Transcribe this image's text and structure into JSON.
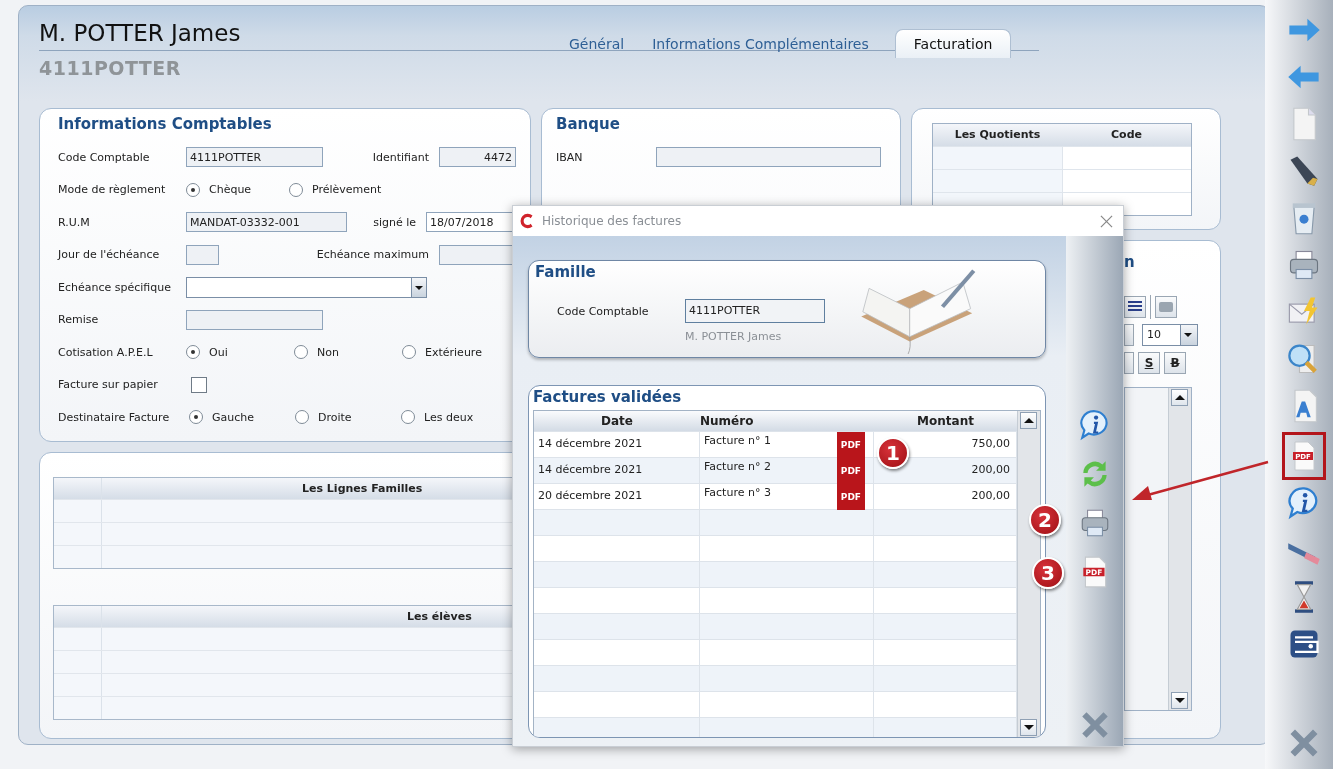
{
  "header": {
    "name": "M. POTTER James",
    "code": "4111POTTER"
  },
  "tabs": [
    {
      "label": "Général",
      "selected": false
    },
    {
      "label": "Informations Complémentaires",
      "selected": false
    },
    {
      "label": "Facturation",
      "selected": true
    }
  ],
  "comptables": {
    "title": "Informations Comptables",
    "code": {
      "label": "Code Comptable",
      "value": "4111POTTER"
    },
    "identifiant": {
      "label": "Identifiant",
      "value": "4472"
    },
    "mode": {
      "label": "Mode de règlement",
      "options": [
        {
          "label": "Chèque",
          "selected": true
        },
        {
          "label": "Prélèvement",
          "selected": false
        }
      ]
    },
    "rum": {
      "label": "R.U.M",
      "value": "MANDAT-03332-001"
    },
    "signe": {
      "label": "signé le",
      "value": "18/07/2018"
    },
    "jour": {
      "label": "Jour de l'échéance"
    },
    "maximum": {
      "label": "Echéance maximum"
    },
    "specifique": {
      "label": "Echéance spécifique"
    },
    "remise": {
      "label": "Remise"
    },
    "apel": {
      "label": "Cotisation A.P.E.L",
      "options": [
        {
          "label": "Oui",
          "selected": true
        },
        {
          "label": "Non",
          "selected": false
        },
        {
          "label": "Extérieure",
          "selected": false
        }
      ]
    },
    "papier": {
      "label": "Facture sur papier",
      "checked": false
    },
    "destinataire": {
      "label": "Destinataire Facture",
      "options": [
        {
          "label": "Gauche",
          "selected": true
        },
        {
          "label": "Droite",
          "selected": false
        },
        {
          "label": "Les deux",
          "selected": false
        }
      ]
    }
  },
  "banque": {
    "title": "Banque",
    "iban_label": "IBAN"
  },
  "quotients": {
    "columns": [
      "Les Quotients",
      "Code"
    ]
  },
  "editor": {
    "title_fragment": "n",
    "font_size": "10",
    "underline_label": "S",
    "strike_label": "B"
  },
  "lignes_familles": {
    "title": "Les Lignes Familles"
  },
  "eleves": {
    "title": "Les élèves"
  },
  "dialog": {
    "title": "Historique des factures",
    "famille": {
      "title": "Famille",
      "code_label": "Code Comptable",
      "code_value": "4111POTTER",
      "name": "M. POTTER James"
    },
    "factures": {
      "title": "Factures validées",
      "columns": [
        "Date",
        "Numéro",
        "Montant"
      ],
      "rows": [
        {
          "date": "14 décembre 2021",
          "numero": "Facture n° 1",
          "badge": "PDF",
          "montant": "750,00"
        },
        {
          "date": "14 décembre 2021",
          "numero": "Facture n° 2",
          "badge": "PDF",
          "montant": "200,00"
        },
        {
          "date": "20 décembre 2021",
          "numero": "Facture n° 3",
          "badge": "PDF",
          "montant": "200,00"
        }
      ]
    },
    "pdf_tool_label": "PDF"
  },
  "annotations": [
    {
      "number": "1"
    },
    {
      "number": "2"
    },
    {
      "number": "3"
    }
  ],
  "side_toolbar": [
    {
      "highlighted": false
    },
    {
      "highlighted": false
    },
    {
      "highlighted": false
    },
    {
      "highlighted": false
    },
    {
      "highlighted": false
    },
    {
      "highlighted": false
    },
    {
      "highlighted": false
    },
    {
      "highlighted": false
    },
    {
      "highlighted": false
    },
    {
      "label": "PDF",
      "highlighted": true
    },
    {
      "highlighted": false
    },
    {
      "highlighted": false
    },
    {
      "highlighted": false
    },
    {
      "highlighted": false
    },
    {
      "highlighted": false
    }
  ]
}
